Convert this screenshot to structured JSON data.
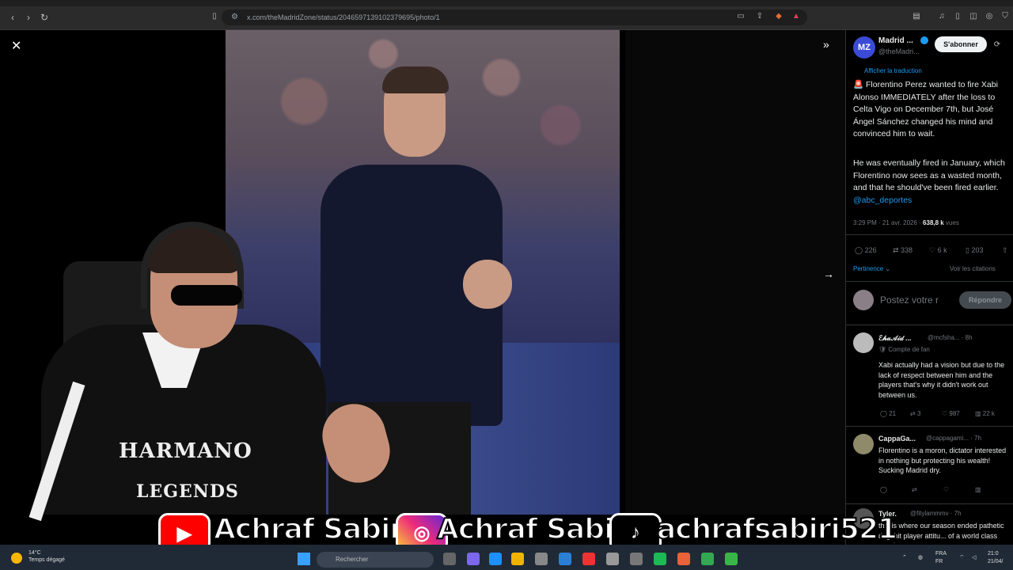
{
  "browser": {
    "url": "x.com/theMadridZone/status/2046597139102379695/photo/1",
    "back": "‹",
    "forward": "›",
    "reload": "↻"
  },
  "viewer": {
    "close": "✕",
    "expand": "»",
    "next": "→"
  },
  "account": {
    "avatar_initials": "MZ",
    "name": "Madrid ...",
    "handle": "@theMadri...",
    "subscribe_label": "S'abonner"
  },
  "tweet": {
    "translate_label": "Afficher la traduction",
    "paragraph1": "🚨 Florentino Perez wanted to fire Xabi Alonso IMMEDIATELY after the loss to Celta Vigo on December 7th, but José Ángel Sánchez changed his mind and convinced him to wait.",
    "paragraph2": "He was eventually fired in January, which Florentino now sees as a wasted month, and that he should've been fired earlier.",
    "mention": "@abc_deportes",
    "time": "3:29 PM · 21 avr. 2026 · ",
    "views": "638,8 k",
    "views_label": " vues",
    "stats": {
      "replies": "226",
      "retweets": "338",
      "likes": "6 k",
      "bookmarks": "203"
    },
    "relevance_label": "Pertinence ⌄",
    "quotes_label": "Voir les citations"
  },
  "reply_box": {
    "placeholder": "Postez votre r",
    "button": "Répondre"
  },
  "comments": [
    {
      "name": "ℰ𝒽𝒶𝒜𝒾𝒹 ...",
      "handle": "@mcfsha... · 8h",
      "sub": "🛡 Compte de fan",
      "text": "Xabi actually had a vision but due to the lack of respect between him and the players that's why it didn't work out between us.",
      "replies": "21",
      "retweets": "3",
      "likes": "987",
      "views": "22 k"
    },
    {
      "name": "CappaGa...",
      "handle": "@cappagami... · 7h",
      "text": "Florentino is a moron, dictator interested in nothing but protecting his wealth! Sucking Madrid dry."
    },
    {
      "name": "Tyler.",
      "handle": "@fitylammmv · 7h",
      "text": "this is where our season ended pathetic dogshit player attitu... of a world class coach"
    }
  ],
  "streamer": {
    "hoodie_line1": "HARMANO",
    "hoodie_line2": "LEGENDS"
  },
  "watermark": {
    "youtube_name": "Achraf Sabiri",
    "instagram_name": "Achraf Sabiri",
    "tiktok_name": "achrafsabiri521"
  },
  "taskbar": {
    "weather_temp": "14°C",
    "weather_desc": "Temps dégagé",
    "search_placeholder": "Rechercher",
    "lang1": "FRA",
    "lang2": "FR",
    "clock": "21:0",
    "date": "21/04/"
  }
}
